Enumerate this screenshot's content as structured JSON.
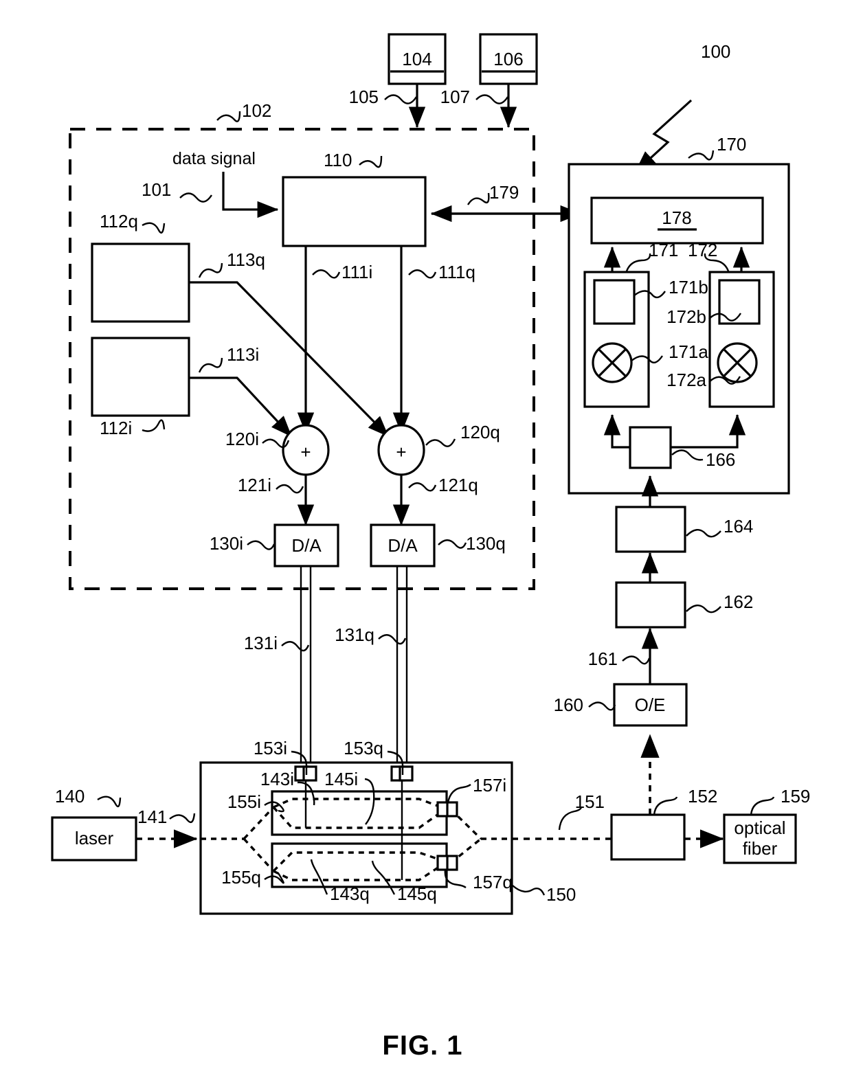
{
  "figure": {
    "caption": "FIG. 1",
    "system_ref": "100"
  },
  "refs": {
    "r100": "100",
    "r101": "101",
    "r102": "102",
    "r104": "104",
    "r105": "105",
    "r106": "106",
    "r107": "107",
    "r110": "110",
    "r111i": "111i",
    "r111q": "111q",
    "r112i": "112i",
    "r112q": "112q",
    "r113i": "113i",
    "r113q": "113q",
    "r120i": "120i",
    "r120q": "120q",
    "r121i": "121i",
    "r121q": "121q",
    "r130i": "130i",
    "r130q": "130q",
    "r131i": "131i",
    "r131q": "131q",
    "r140": "140",
    "r141": "141",
    "r143i": "143i",
    "r143q": "143q",
    "r145i": "145i",
    "r145q": "145q",
    "r150": "150",
    "r151": "151",
    "r152": "152",
    "r153i": "153i",
    "r153q": "153q",
    "r155i": "155i",
    "r155q": "155q",
    "r157i": "157i",
    "r157q": "157q",
    "r159": "159",
    "r160": "160",
    "r161": "161",
    "r162": "162",
    "r164": "164",
    "r166": "166",
    "r170": "170",
    "r171": "171",
    "r171a": "171a",
    "r171b": "171b",
    "r172": "172",
    "r172a": "172a",
    "r172b": "172b",
    "r178": "178",
    "r179": "179"
  },
  "blocks": {
    "data_signal_label": "data signal",
    "box_104": "104",
    "box_106": "106",
    "box_110": "",
    "box_112i": "",
    "box_112q": "",
    "da_i": "D/A",
    "da_q": "D/A",
    "laser": "laser",
    "optical_fiber_line1": "optical",
    "optical_fiber_line2": "fiber",
    "oe": "O/E",
    "box_178": "178",
    "box_152": "",
    "box_162": "",
    "box_164": "",
    "box_166": "",
    "adder_i": "+",
    "adder_q": "+"
  },
  "colors": {
    "stroke": "#000000",
    "fill": "#ffffff",
    "background": "#ffffff"
  }
}
